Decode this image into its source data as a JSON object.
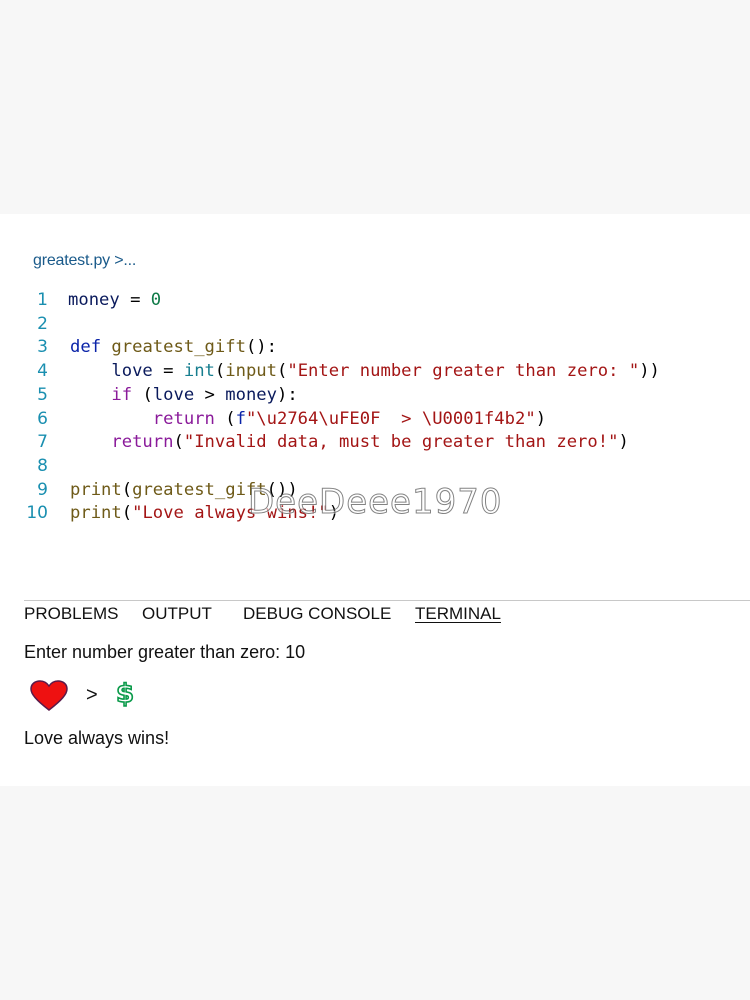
{
  "editor": {
    "breadcrumb": "greatest.py >...",
    "lines": [
      {
        "num": "1",
        "tokens": [
          {
            "t": "money",
            "c": "var"
          },
          {
            "t": " = ",
            "c": "punc"
          },
          {
            "t": "0",
            "c": "num"
          }
        ]
      },
      {
        "num": "2",
        "tokens": []
      },
      {
        "num": "3",
        "tokens": [
          {
            "t": "def",
            "c": "kw-blue"
          },
          {
            "t": " ",
            "c": "punc"
          },
          {
            "t": "greatest_gift",
            "c": "fn"
          },
          {
            "t": "():",
            "c": "punc"
          }
        ]
      },
      {
        "num": "4",
        "tokens": [
          {
            "t": "    love",
            "c": "var"
          },
          {
            "t": " = ",
            "c": "punc"
          },
          {
            "t": "int",
            "c": "builtin"
          },
          {
            "t": "(",
            "c": "punc"
          },
          {
            "t": "input",
            "c": "fn"
          },
          {
            "t": "(",
            "c": "punc"
          },
          {
            "t": "\"Enter number greater than zero: \"",
            "c": "str"
          },
          {
            "t": "))",
            "c": "punc"
          }
        ]
      },
      {
        "num": "5",
        "tokens": [
          {
            "t": "    if",
            "c": "ctrl"
          },
          {
            "t": " (",
            "c": "punc"
          },
          {
            "t": "love",
            "c": "var"
          },
          {
            "t": " > ",
            "c": "punc"
          },
          {
            "t": "money",
            "c": "var"
          },
          {
            "t": "):",
            "c": "punc"
          }
        ]
      },
      {
        "num": "6",
        "tokens": [
          {
            "t": "        return",
            "c": "ctrl"
          },
          {
            "t": " (",
            "c": "punc"
          },
          {
            "t": "f",
            "c": "kw-blue"
          },
          {
            "t": "\"\\u2764\\uFE0F  > \\U0001f4b2\"",
            "c": "str"
          },
          {
            "t": ")",
            "c": "punc"
          }
        ]
      },
      {
        "num": "7",
        "tokens": [
          {
            "t": "    return",
            "c": "ctrl"
          },
          {
            "t": "(",
            "c": "punc"
          },
          {
            "t": "\"Invalid data, must be greater than zero!\"",
            "c": "str"
          },
          {
            "t": ")",
            "c": "punc"
          }
        ]
      },
      {
        "num": "8",
        "tokens": []
      },
      {
        "num": "9",
        "tokens": [
          {
            "t": "print",
            "c": "fn"
          },
          {
            "t": "(",
            "c": "punc"
          },
          {
            "t": "greatest_gift",
            "c": "fn"
          },
          {
            "t": "())",
            "c": "punc"
          }
        ]
      },
      {
        "num": "10",
        "tokens": [
          {
            "t": "print",
            "c": "fn"
          },
          {
            "t": "(",
            "c": "punc"
          },
          {
            "t": "\"Love always wins!\"",
            "c": "str"
          },
          {
            "t": ")",
            "c": "punc"
          }
        ]
      }
    ]
  },
  "panel": {
    "tabs": [
      {
        "label": "PROBLEMS",
        "active": false
      },
      {
        "label": "OUTPUT",
        "active": false
      },
      {
        "label": "DEBUG CONSOLE",
        "active": false
      },
      {
        "label": "TERMINAL",
        "active": true
      }
    ],
    "terminal": {
      "prompt_line": "Enter number greater than zero: 10",
      "result_icons": {
        "left": "red-heart-icon",
        "operator": ">",
        "right": "heavy-dollar-sign-icon"
      },
      "last_line": "Love always wins!"
    }
  },
  "watermark": "DeeDeee1970",
  "colors": {
    "line_number": "#1a8fb0",
    "string": "#a31515",
    "keyword": "#0a23a8",
    "control": "#8a1a9a",
    "function": "#6e5a18",
    "builtin": "#177e8f",
    "number": "#0e7a47",
    "heart": "#ee1111",
    "dollar": "#0a9a4a"
  }
}
